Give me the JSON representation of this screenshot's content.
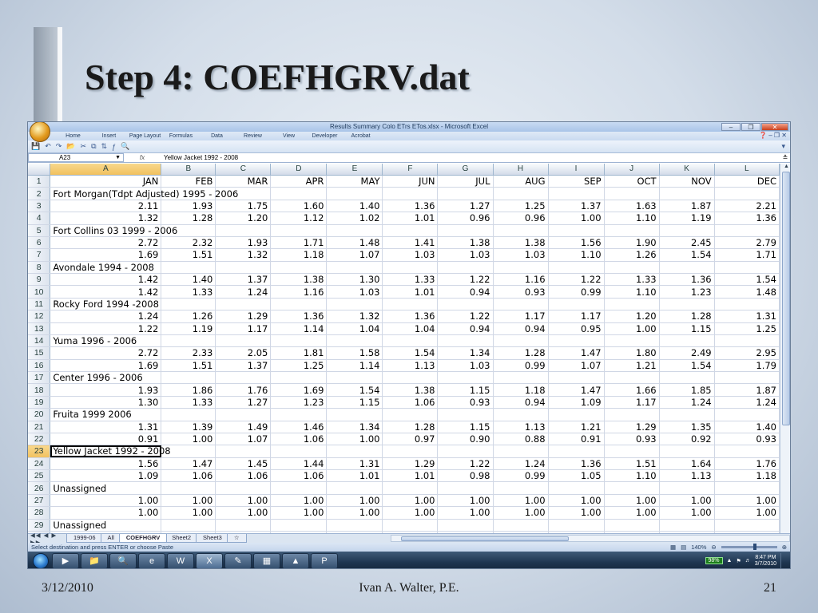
{
  "slide": {
    "title": "Step 4:  COEFHGRV.dat",
    "footer_date": "3/12/2010",
    "footer_author": "Ivan A. Walter, P.E.",
    "footer_page": "21"
  },
  "excel": {
    "window_title": "Results Summary  Colo ETrs ETos.xlsx - Microsoft Excel",
    "ribbon_tabs": [
      "Home",
      "Insert",
      "Page Layout",
      "Formulas",
      "Data",
      "Review",
      "View",
      "Developer",
      "Acrobat"
    ],
    "name_box": "A23",
    "formula": "Yellow Jacket  1992 - 2008",
    "fx_symbol": "fx",
    "selected_column": "A",
    "selected_row": "23",
    "columns": [
      "A",
      "B",
      "C",
      "D",
      "E",
      "F",
      "G",
      "H",
      "I",
      "J",
      "K",
      "L"
    ],
    "rows": [
      [
        "JAN",
        "FEB",
        "MAR",
        "APR",
        "MAY",
        "JUN",
        "JUL",
        "AUG",
        "SEP",
        "OCT",
        "NOV",
        "DEC"
      ],
      [
        "Fort Morgan(Tdpt Adjusted)  1995 - 2006"
      ],
      [
        "2.11",
        "1.93",
        "1.75",
        "1.60",
        "1.40",
        "1.36",
        "1.27",
        "1.25",
        "1.37",
        "1.63",
        "1.87",
        "2.21"
      ],
      [
        "1.32",
        "1.28",
        "1.20",
        "1.12",
        "1.02",
        "1.01",
        "0.96",
        "0.96",
        "1.00",
        "1.10",
        "1.19",
        "1.36"
      ],
      [
        "Fort Collins 03  1999 - 2006"
      ],
      [
        "2.72",
        "2.32",
        "1.93",
        "1.71",
        "1.48",
        "1.41",
        "1.38",
        "1.38",
        "1.56",
        "1.90",
        "2.45",
        "2.79"
      ],
      [
        "1.69",
        "1.51",
        "1.32",
        "1.18",
        "1.07",
        "1.03",
        "1.03",
        "1.03",
        "1.10",
        "1.26",
        "1.54",
        "1.71"
      ],
      [
        "Avondale 1994 - 2008"
      ],
      [
        "1.42",
        "1.40",
        "1.37",
        "1.38",
        "1.30",
        "1.33",
        "1.22",
        "1.16",
        "1.22",
        "1.33",
        "1.36",
        "1.54"
      ],
      [
        "1.42",
        "1.33",
        "1.24",
        "1.16",
        "1.03",
        "1.01",
        "0.94",
        "0.93",
        "0.99",
        "1.10",
        "1.23",
        "1.48"
      ],
      [
        "Rocky Ford 1994 -2008"
      ],
      [
        "1.24",
        "1.26",
        "1.29",
        "1.36",
        "1.32",
        "1.36",
        "1.22",
        "1.17",
        "1.17",
        "1.20",
        "1.28",
        "1.31"
      ],
      [
        "1.22",
        "1.19",
        "1.17",
        "1.14",
        "1.04",
        "1.04",
        "0.94",
        "0.94",
        "0.95",
        "1.00",
        "1.15",
        "1.25"
      ],
      [
        "Yuma  1996  -  2006"
      ],
      [
        "2.72",
        "2.33",
        "2.05",
        "1.81",
        "1.58",
        "1.54",
        "1.34",
        "1.28",
        "1.47",
        "1.80",
        "2.49",
        "2.95"
      ],
      [
        "1.69",
        "1.51",
        "1.37",
        "1.25",
        "1.14",
        "1.13",
        "1.03",
        "0.99",
        "1.07",
        "1.21",
        "1.54",
        "1.79"
      ],
      [
        "Center  1996 - 2006"
      ],
      [
        "1.93",
        "1.86",
        "1.76",
        "1.69",
        "1.54",
        "1.38",
        "1.15",
        "1.18",
        "1.47",
        "1.66",
        "1.85",
        "1.87"
      ],
      [
        "1.30",
        "1.33",
        "1.27",
        "1.23",
        "1.15",
        "1.06",
        "0.93",
        "0.94",
        "1.09",
        "1.17",
        "1.24",
        "1.24"
      ],
      [
        "Fruita  1999 2006"
      ],
      [
        "1.31",
        "1.39",
        "1.49",
        "1.46",
        "1.34",
        "1.28",
        "1.15",
        "1.13",
        "1.21",
        "1.29",
        "1.35",
        "1.40"
      ],
      [
        "0.91",
        "1.00",
        "1.07",
        "1.06",
        "1.00",
        "0.97",
        "0.90",
        "0.88",
        "0.91",
        "0.93",
        "0.92",
        "0.93"
      ],
      [
        "Yellow Jacket  1992 - 2008"
      ],
      [
        "1.56",
        "1.47",
        "1.45",
        "1.44",
        "1.31",
        "1.29",
        "1.22",
        "1.24",
        "1.36",
        "1.51",
        "1.64",
        "1.76"
      ],
      [
        "1.09",
        "1.06",
        "1.06",
        "1.06",
        "1.01",
        "1.01",
        "0.98",
        "0.99",
        "1.05",
        "1.10",
        "1.13",
        "1.18"
      ],
      [
        "Unassigned"
      ],
      [
        "1.00",
        "1.00",
        "1.00",
        "1.00",
        "1.00",
        "1.00",
        "1.00",
        "1.00",
        "1.00",
        "1.00",
        "1.00",
        "1.00"
      ],
      [
        "1.00",
        "1.00",
        "1.00",
        "1.00",
        "1.00",
        "1.00",
        "1.00",
        "1.00",
        "1.00",
        "1.00",
        "1.00",
        "1.00"
      ],
      [
        "Unassigned"
      ],
      [
        "1.00",
        "1.00",
        "1.00",
        "1.00",
        "1.00",
        "1.00",
        "1.00",
        "1.00",
        "1.00",
        "1.00",
        "1.00",
        "1.00"
      ]
    ],
    "sheet_tabs": [
      "1999-06",
      "All",
      "COEFHGRV",
      "Sheet2",
      "Sheet3"
    ],
    "active_sheet": "COEFHGRV",
    "status_text": "Select destination and press ENTER or choose Paste",
    "zoom": "140%",
    "battery": "98%",
    "clock_time": "8:47 PM",
    "clock_date": "3/7/2010"
  }
}
